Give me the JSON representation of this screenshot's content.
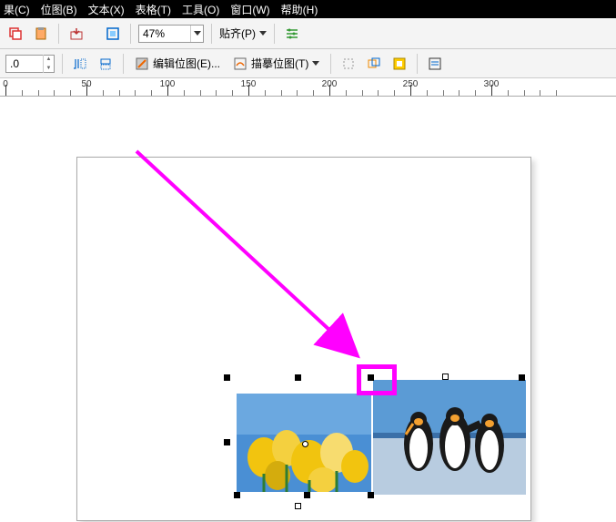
{
  "menu": {
    "items": [
      "果(C)",
      "位图(B)",
      "文本(X)",
      "表格(T)",
      "工具(O)",
      "窗口(W)",
      "帮助(H)"
    ]
  },
  "toolbar1": {
    "zoom_value": "47%",
    "snap_label": "贴齐(P)"
  },
  "toolbar2": {
    "coord_value": ".0",
    "edit_bitmap_label": "编辑位图(E)...",
    "trace_bitmap_label": "描摹位图(T)"
  },
  "ruler": {
    "start": 0,
    "major_ticks": [
      0,
      50,
      100,
      150,
      200,
      250,
      300
    ],
    "minor_step": 10
  },
  "annotation": {
    "type": "highlight-box-arrow",
    "color": "#ff00ff"
  },
  "selected_objects": {
    "count": 2,
    "descriptions": [
      "tulips-photo",
      "penguins-photo"
    ]
  }
}
